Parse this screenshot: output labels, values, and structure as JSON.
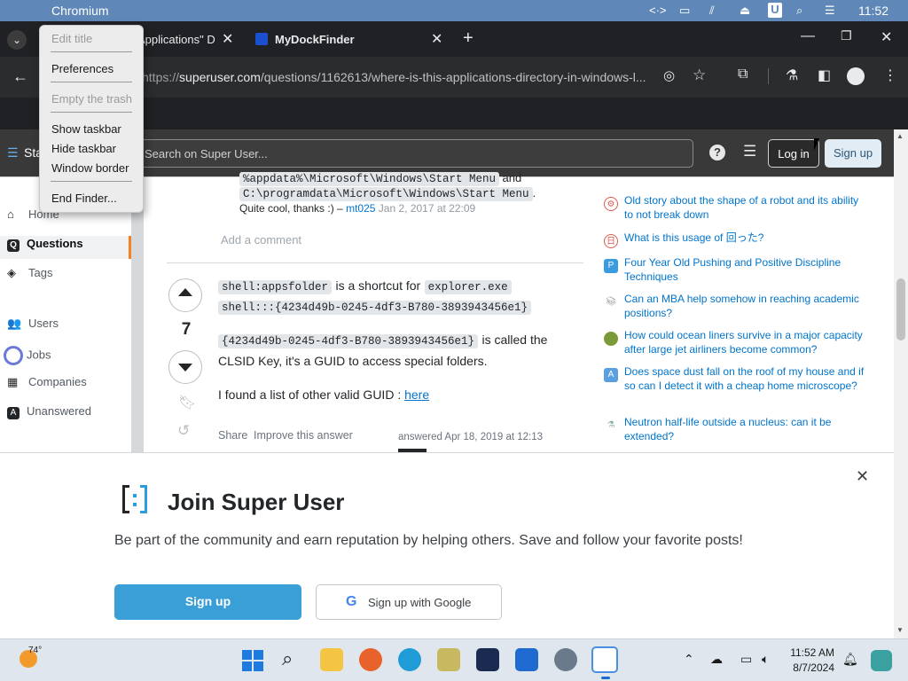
{
  "macbar": {
    "app_name": "Chromium",
    "clock": "11:52"
  },
  "browser": {
    "tabs": [
      {
        "title": "Applications\" D"
      },
      {
        "title": "MyDockFinder"
      }
    ],
    "url_prefix": "https://",
    "url_domain": "superuser.com",
    "url_rest": "/questions/1162613/where-is-this-applications-directory-in-windows-l..."
  },
  "site": {
    "logo_fragment": "Sta",
    "search_placeholder": "Search on Super User...",
    "login_label": "Log in",
    "signup_label": "Sign up"
  },
  "context_menu": {
    "items": [
      {
        "label": "Edit title",
        "enabled": false
      },
      {
        "label": "Preferences",
        "enabled": true
      },
      {
        "label": "Empty the trash",
        "enabled": false
      },
      {
        "label": "Show taskbar",
        "enabled": true
      },
      {
        "label": "Hide taskbar",
        "enabled": true
      },
      {
        "label": "Window border",
        "enabled": true
      },
      {
        "label": "End Finder...",
        "enabled": true
      }
    ]
  },
  "leftnav": {
    "items": [
      {
        "label": "Home",
        "icon": "home-icon"
      },
      {
        "label": "Questions",
        "icon": "questions-icon"
      },
      {
        "label": "Tags",
        "icon": "tag-icon"
      },
      {
        "label": "Users",
        "icon": "users-icon"
      },
      {
        "label": "Jobs",
        "icon": "briefcase-icon"
      },
      {
        "label": "Companies",
        "icon": "building-icon"
      },
      {
        "label": "Unanswered",
        "icon": "unanswered-icon"
      }
    ]
  },
  "comment": {
    "code1": "%appdata%\\Microsoft\\Windows\\Start Menu",
    "and": "and",
    "code2": "C:\\programdata\\Microsoft\\Windows\\Start Menu",
    "text": "Quite cool, thanks :) –",
    "author": "mt025",
    "date": "Jan 2, 2017 at 22:09",
    "add_comment": "Add a comment"
  },
  "answer": {
    "votes": "7",
    "code_a": "shell:appsfolder",
    "text_a": "is a shortcut for",
    "code_b": "explorer.exe",
    "code_c": "shell:::{4234d49b-0245-4df3-B780-3893943456e1}",
    "code_d": "{4234d49b-0245-4df3-B780-3893943456e1}",
    "text_b": "is called the",
    "text_c": "CLSID Key, it's a GUID to access special folders.",
    "text_d": "I found a list of other valid GUID :",
    "link": "here",
    "share": "Share",
    "improve": "Improve this answer",
    "answered": "answered Apr 18, 2019 at 12:13"
  },
  "hot_questions": [
    {
      "title": "Old story about the shape of a robot and its ability to not break down",
      "icon_color": "#e05a4f"
    },
    {
      "title": "What is this usage of 回った?",
      "icon_color": "#e05a4f"
    },
    {
      "title": "Four Year Old Pushing and Positive Discipline Techniques",
      "icon_color": "#3b9be0"
    },
    {
      "title": "Can an MBA help somehow in reaching academic positions?",
      "icon_color": "#a0a0a0"
    },
    {
      "title": "How could ocean liners survive in a major capacity after large jet airliners become common?",
      "icon_color": "#7a9a3a"
    },
    {
      "title": "Does space dust fall on the roof of my house and if so can I detect it with a cheap home microscope?",
      "icon_color": "#5aa0e0"
    },
    {
      "title": "Neutron half-life outside a nucleus: can it be extended?",
      "icon_color": "#8ab0a0"
    }
  ],
  "banner": {
    "title": "Join Super User",
    "text": "Be part of the community and earn reputation by helping others. Save and follow your favorite posts!",
    "signup": "Sign up",
    "google": "Sign up with Google"
  },
  "taskbar": {
    "weather": "74°",
    "time": "11:52 AM",
    "date": "8/7/2024"
  }
}
